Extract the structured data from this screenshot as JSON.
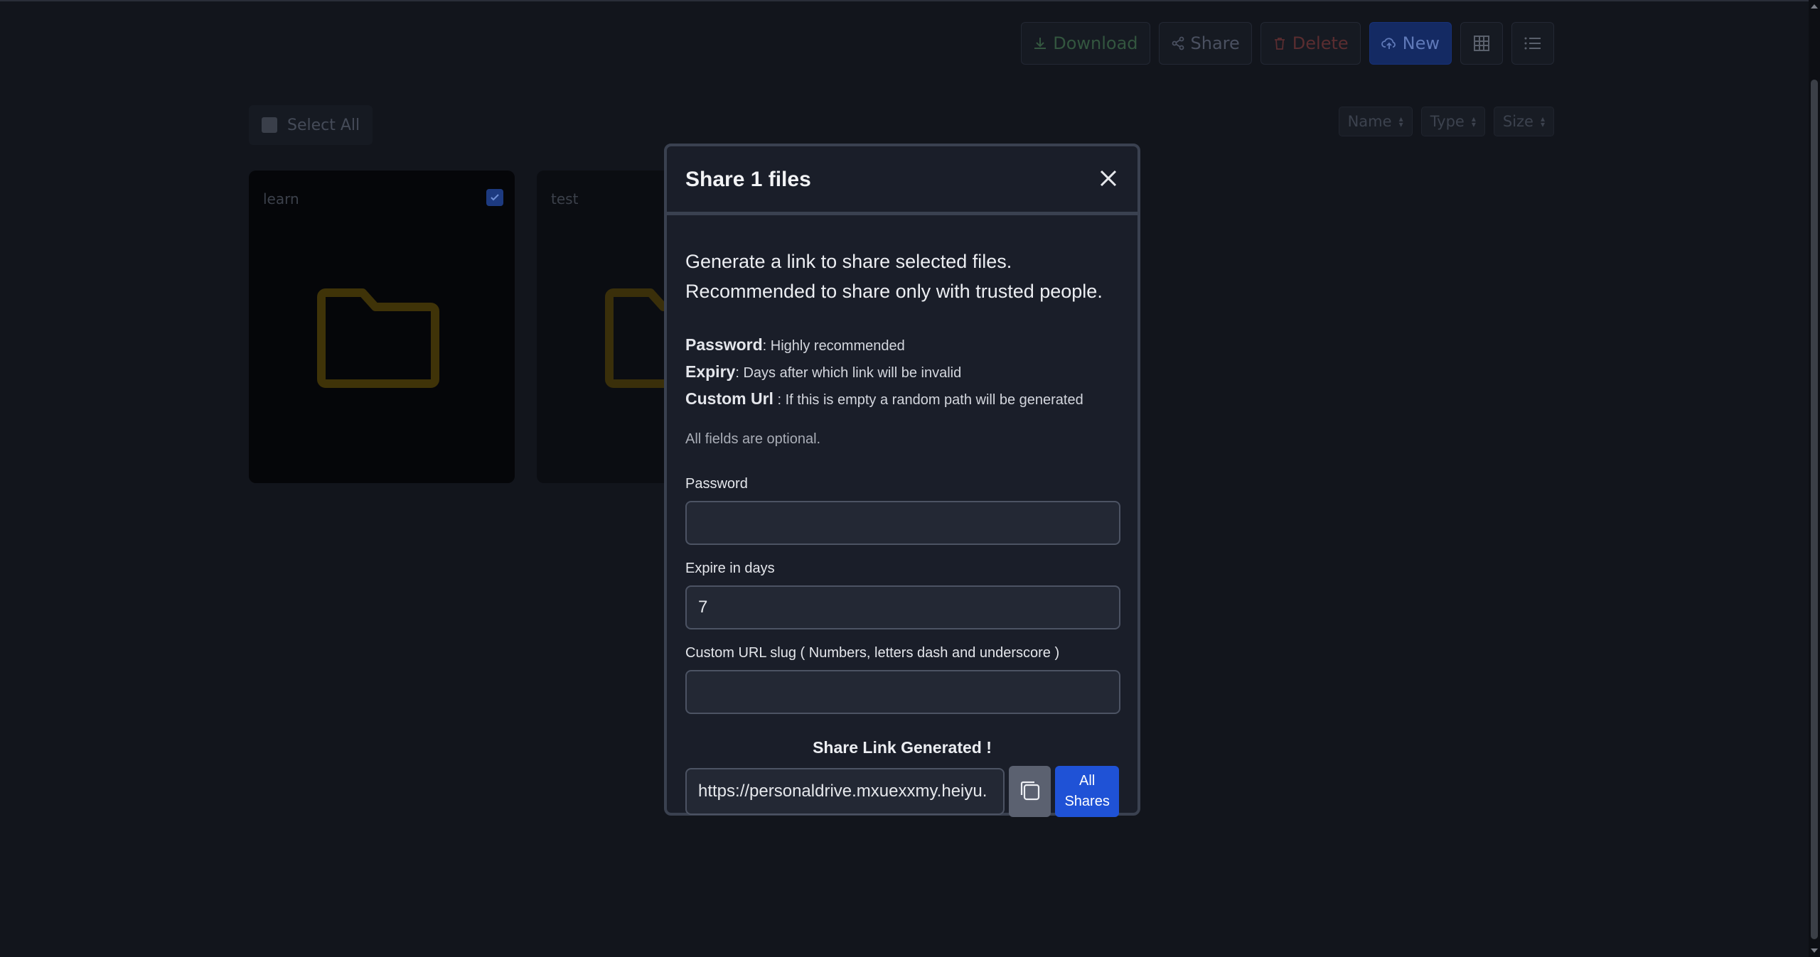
{
  "toolbar": {
    "download_label": "Download",
    "share_label": "Share",
    "delete_label": "Delete",
    "new_label": "New"
  },
  "select_all_label": "Select All",
  "sort": {
    "name_label": "Name",
    "type_label": "Type",
    "size_label": "Size"
  },
  "files": [
    {
      "name": "learn",
      "selected": true
    },
    {
      "name": "test",
      "selected": false
    }
  ],
  "modal": {
    "title": "Share 1 files",
    "intro_line1": "Generate a link to share selected files.",
    "intro_line2": "Recommended to share only with trusted people.",
    "help": {
      "password_term": "Password",
      "password_desc": ": Highly recommended",
      "expiry_term": "Expiry",
      "expiry_desc": ": Days after which link will be invalid",
      "custom_term": "Custom Url",
      "custom_desc": " : If this is empty a random path will be generated"
    },
    "optional_note": "All fields are optional.",
    "password_label": "Password",
    "password_value": "",
    "expire_label": "Expire in days",
    "expire_value": "7",
    "slug_label": "Custom URL slug ( Numbers, letters dash and underscore )",
    "slug_value": "",
    "generated_label": "Share Link Generated !",
    "share_link_value": "https://personaldrive.mxuexxmy.heiyu.",
    "all_shares_line1": "All",
    "all_shares_line2": "Shares"
  },
  "colors": {
    "accent": "#1f52d6",
    "modal_bg": "#1a1e29",
    "page_bg": "#12151c"
  }
}
